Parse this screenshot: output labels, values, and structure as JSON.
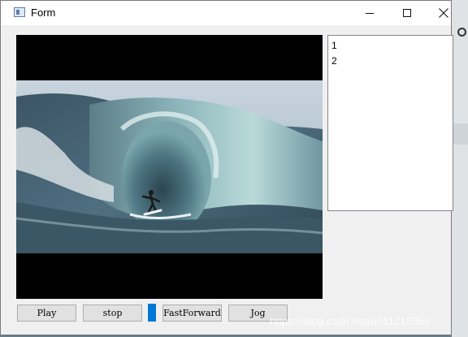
{
  "window": {
    "title": "Form",
    "icon": "app-form-icon"
  },
  "controls": {
    "minimize": "minimize-icon",
    "maximize": "maximize-icon",
    "close": "close-icon"
  },
  "video": {
    "content": "surfer riding inside a large breaking wave"
  },
  "list": {
    "items": [
      "1",
      "2"
    ]
  },
  "buttons": {
    "play": "Play",
    "stop": "stop",
    "fast_forward": "FastForward",
    "jog": "Jog"
  },
  "slider": {
    "color": "#0078d7"
  },
  "watermark": "https://blog.csdn.net/u011218356"
}
